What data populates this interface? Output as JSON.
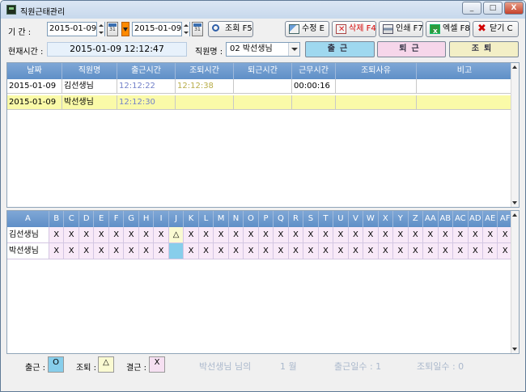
{
  "window": {
    "title": "직원근태관리",
    "controls": [
      "_",
      "□",
      "X"
    ]
  },
  "filter": {
    "period_label": "기    간 :",
    "date_from": "2015-01-09",
    "date_to": "2015-01-09",
    "calendar_glyph": "31",
    "buttons": {
      "search": "조회 F5",
      "edit": "수정 E",
      "delete": "삭제 F4",
      "print": "인쇄 F7",
      "excel": "엑셀 F8",
      "close": "닫기 C"
    }
  },
  "status_row": {
    "current_time_label": "현재시간 :",
    "current_time": "2015-01-09  12:12:47",
    "employee_label": "직원명 :",
    "employee_selected": "02 박선생님",
    "buttons": {
      "checkin": "출근",
      "checkout": "퇴근",
      "early_leave": "조퇴"
    },
    "colors": {
      "checkin": "#9fd8ef",
      "checkout": "#f6d6ea",
      "early_leave": "#f3efc6"
    }
  },
  "attendance_table": {
    "columns": [
      "날짜",
      "직원명",
      "출근시간",
      "조퇴시간",
      "퇴근시간",
      "근무시간",
      "조퇴사유",
      "비고"
    ],
    "rows": [
      {
        "date": "2015-01-09",
        "name": "김선생님",
        "checkin": "12:12:22",
        "early_leave": "12:12:38",
        "checkout": "",
        "worktime": "00:00:16",
        "reason": "",
        "note": ""
      },
      {
        "date": "2015-01-09",
        "name": "박선생님",
        "checkin": "12:12:30",
        "early_leave": "",
        "checkout": "",
        "worktime": "",
        "reason": "",
        "note": ""
      }
    ]
  },
  "monthly_table": {
    "columns": [
      "A",
      "B",
      "C",
      "D",
      "E",
      "F",
      "G",
      "H",
      "I",
      "J",
      "K",
      "L",
      "M",
      "N",
      "O",
      "P",
      "Q",
      "R",
      "S",
      "T",
      "U",
      "V",
      "W",
      "X",
      "Y",
      "Z",
      "AA",
      "AB",
      "AC",
      "AD",
      "AE",
      "AF"
    ],
    "rows": [
      {
        "name": "김선생님",
        "cells": [
          "X",
          "X",
          "X",
          "X",
          "X",
          "X",
          "X",
          "X",
          "△",
          "X",
          "X",
          "X",
          "X",
          "X",
          "X",
          "X",
          "X",
          "X",
          "X",
          "X",
          "X",
          "X",
          "X",
          "X",
          "X",
          "X",
          "X",
          "X",
          "X",
          "X",
          "X"
        ]
      },
      {
        "name": "박선생님",
        "cells": [
          "X",
          "X",
          "X",
          "X",
          "X",
          "X",
          "X",
          "X",
          "",
          "X",
          "X",
          "X",
          "X",
          "X",
          "X",
          "X",
          "X",
          "X",
          "X",
          "X",
          "X",
          "X",
          "X",
          "X",
          "X",
          "X",
          "X",
          "X",
          "X",
          "X",
          "X"
        ]
      }
    ],
    "highlight_color": "#87ceeb"
  },
  "legend": {
    "checkin_label": "출근 :",
    "checkin_symbol": "O",
    "early_leave_label": "조퇴 :",
    "early_leave_symbol": "△",
    "absent_label": "결근 :",
    "absent_symbol": "X",
    "colors": {
      "checkin": "#87ceeb",
      "early_leave": "#fafad2",
      "absent": "#f6e0f2"
    }
  },
  "summary": {
    "name_text": "박선생님 님의",
    "month_text": "1 월",
    "checkin_days_text": "출근일수 : 1",
    "early_leave_days_text": "조퇴일수 : 0"
  }
}
